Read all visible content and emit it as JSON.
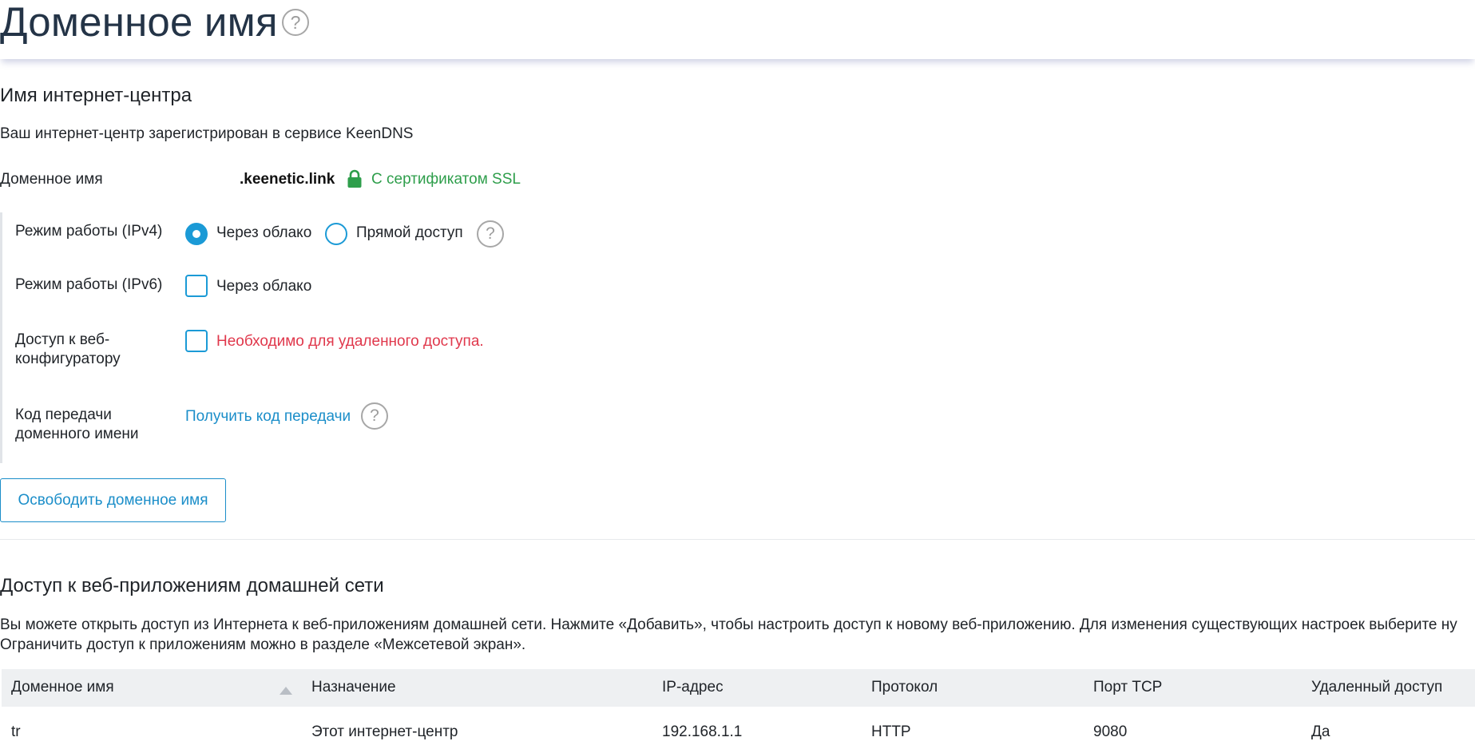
{
  "header": {
    "title": "Доменное имя",
    "help_glyph": "?"
  },
  "center_name": {
    "title": "Имя интернет-центра",
    "description": "Ваш интернет-центр зарегистрирован в сервисе KeenDNS",
    "domain_label": "Доменное имя",
    "domain_value": ".keenetic.link",
    "ssl_status": "С сертификатом SSL",
    "ssl_color": "#2e9e4b",
    "mode_ipv4": {
      "label": "Режим работы (IPv4)",
      "option_cloud": "Через облако",
      "option_direct": "Прямой доступ",
      "selected": "Через облако"
    },
    "mode_ipv6": {
      "label": "Режим работы (IPv6)",
      "option_cloud": "Через облако",
      "checked": false
    },
    "web_config": {
      "label_line1": "Доступ к веб-",
      "label_line2": "конфигуратору",
      "warning": "Необходимо для удаленного доступа.",
      "checked": false
    },
    "transfer_code": {
      "label_line1": "Код передачи",
      "label_line2": "доменного имени",
      "link": "Получить код передачи"
    },
    "release_button": "Освободить доменное имя",
    "accent_color": "#1b9ad6",
    "warning_color": "#e0384c"
  },
  "web_apps": {
    "title": "Доступ к веб-приложениям домашней сети",
    "paragraph_line1": "Вы можете открыть доступ из Интернета к веб-приложениям домашней сети. Нажмите «Добавить», чтобы настроить доступ к новому веб-приложению. Для изменения существующих настроек выберите ну",
    "paragraph_line2": "Ограничить доступ к приложениям можно в разделе «Межсетевой экран».",
    "table": {
      "columns": [
        "Доменное имя",
        "Назначение",
        "IP-адрес",
        "Протокол",
        "Порт TCP",
        "Удаленный доступ"
      ],
      "rows": [
        [
          "tr",
          "Этот интернет-центр",
          "192.168.1.1",
          "HTTP",
          "9080",
          "Да"
        ]
      ]
    }
  }
}
